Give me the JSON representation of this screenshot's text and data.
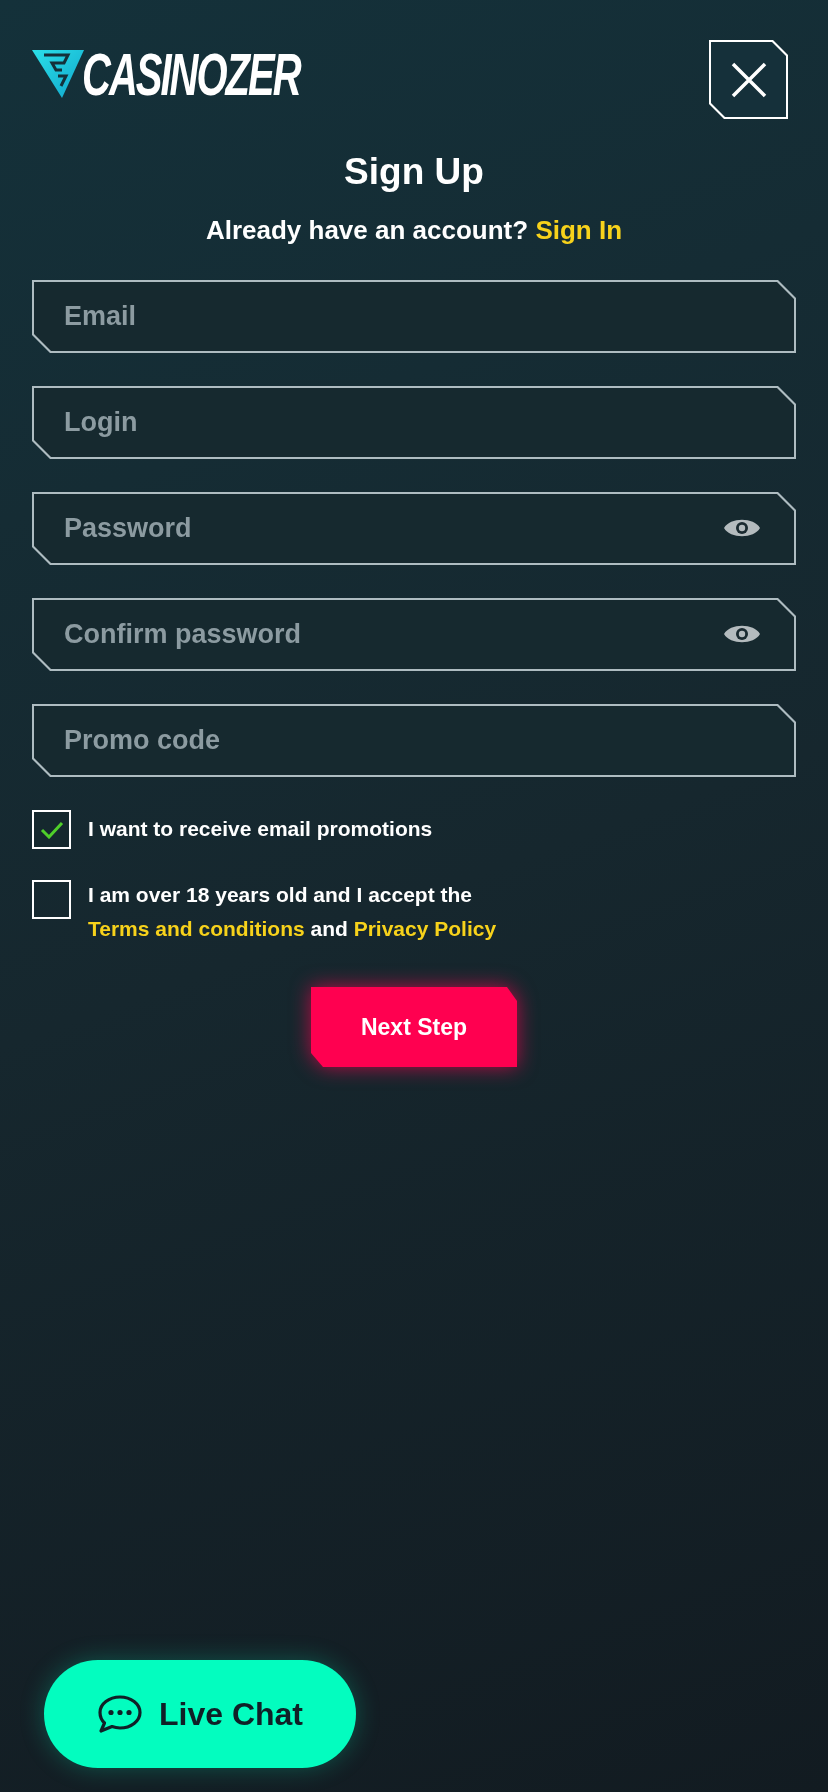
{
  "header": {
    "logo_text": "CASINOZER"
  },
  "title": "Sign Up",
  "subtitle": {
    "text": "Already have an account?",
    "link": "Sign In"
  },
  "fields": [
    {
      "placeholder": "Email",
      "kind": "text"
    },
    {
      "placeholder": "Login",
      "kind": "text"
    },
    {
      "placeholder": "Password",
      "kind": "password"
    },
    {
      "placeholder": "Confirm password",
      "kind": "password"
    },
    {
      "placeholder": "Promo code",
      "kind": "text"
    }
  ],
  "checkboxes": [
    {
      "checked": true,
      "label_parts": [
        {
          "kind": "text",
          "text": "I want to receive email promotions"
        }
      ]
    },
    {
      "checked": false,
      "label_parts": [
        {
          "kind": "text",
          "text": "I am over 18 years old and I accept the"
        },
        {
          "kind": "link",
          "text": "Terms and conditions"
        },
        {
          "kind": "text",
          "text": "and"
        },
        {
          "kind": "link",
          "text": "Privacy Policy"
        }
      ]
    }
  ],
  "next_button": {
    "label": "Next Step"
  },
  "live_chat": {
    "label": "Live Chat"
  }
}
